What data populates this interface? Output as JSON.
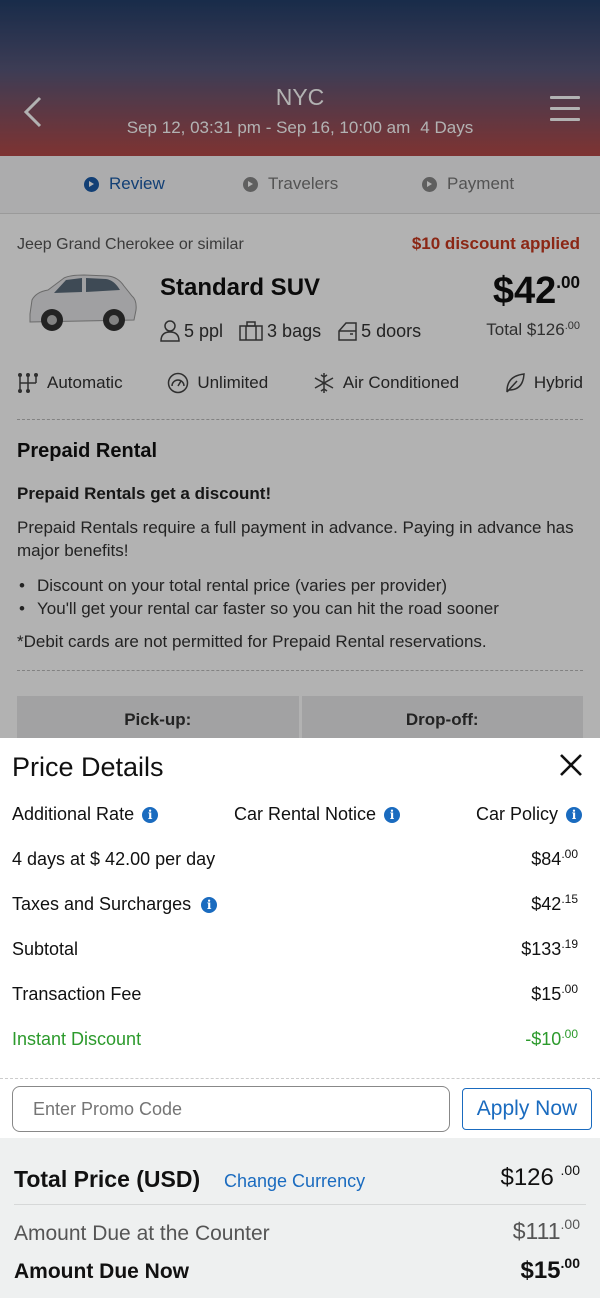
{
  "header": {
    "city": "NYC",
    "dates": "Sep 12, 03:31 pm - Sep 16, 10:00 am",
    "duration": "4 Days"
  },
  "steps": [
    {
      "label": "Review",
      "active": true
    },
    {
      "label": "Travelers",
      "active": false
    },
    {
      "label": "Payment",
      "active": false
    }
  ],
  "car": {
    "similar": "Jeep Grand Cherokee or similar",
    "discount_note": "$10 discount applied",
    "name": "Standard SUV",
    "price_main": "$42",
    "price_cents": ".00",
    "total_main": "Total $126",
    "total_cents": ".00",
    "specs": {
      "people": "5 ppl",
      "bags": "3 bags",
      "doors": "5 doors"
    },
    "features": {
      "transmission": "Automatic",
      "mileage": "Unlimited",
      "ac": "Air Conditioned",
      "fuel": "Hybrid"
    }
  },
  "prepaid": {
    "title": "Prepaid Rental",
    "subtitle": "Prepaid Rentals get a discount!",
    "description": "Prepaid Rentals require a full payment in advance. Paying in advance has major benefits!",
    "bullets": [
      "Discount on your total rental price (varies per provider)",
      "You'll get your rental car faster so you can hit the road sooner"
    ],
    "note": "*Debit cards are not permitted for Prepaid Rental reservations."
  },
  "pickup_dropoff": {
    "pickup": "Pick-up:",
    "dropoff": "Drop-off:"
  },
  "price_details": {
    "title": "Price Details",
    "links": {
      "additional_rate": "Additional Rate",
      "rental_notice": "Car Rental Notice",
      "policy": "Car Policy"
    },
    "rows": {
      "days": {
        "label": "4 days at $ 42.00 per day",
        "amount": "$84",
        "cents": ".00"
      },
      "taxes": {
        "label": "Taxes and Surcharges",
        "amount": "$42",
        "cents": ".15"
      },
      "subtotal": {
        "label": "Subtotal",
        "amount": "$133",
        "cents": ".19"
      },
      "fee": {
        "label": "Transaction Fee",
        "amount": "$15",
        "cents": ".00"
      },
      "discount": {
        "label": "Instant Discount",
        "amount": "-$10",
        "cents": ".00"
      }
    },
    "promo": {
      "placeholder": "Enter Promo Code",
      "apply_label": "Apply Now"
    },
    "totals": {
      "total_label": "Total Price (USD)",
      "change_currency": "Change Currency",
      "total_amount": "$126 ",
      "total_cents": ".00",
      "counter_label": "Amount Due at the Counter",
      "counter_amount": "$111",
      "counter_cents": ".00",
      "due_label": "Amount Due Now",
      "due_amount": "$15",
      "due_cents": ".00"
    }
  },
  "colors": {
    "accent": "#1a6bbf",
    "discount_red": "#c8391f",
    "discount_green": "#2c9a2c"
  },
  "icons": [
    "back-arrow-icon",
    "menu-icon",
    "person-icon",
    "bag-icon",
    "door-icon",
    "transmission-icon",
    "gauge-icon",
    "snowflake-icon",
    "leaf-icon",
    "info-icon",
    "close-icon"
  ]
}
